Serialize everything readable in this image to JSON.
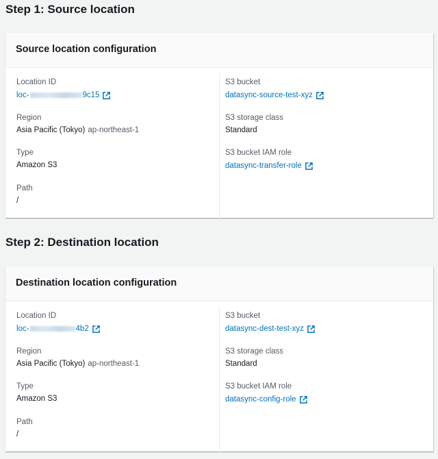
{
  "steps": [
    {
      "heading": "Step 1: Source location",
      "card_title": "Source location configuration",
      "left": [
        {
          "label": "Location ID",
          "value_prefix": "loc-",
          "value_suffix": "9c15",
          "link": true
        },
        {
          "label": "Region",
          "value": "Asia Pacific (Tokyo)",
          "value_sub": "ap-northeast-1"
        },
        {
          "label": "Type",
          "value": "Amazon S3"
        },
        {
          "label": "Path",
          "value": "/"
        }
      ],
      "right": [
        {
          "label": "S3 bucket",
          "value": "datasync-source-test-xyz",
          "link": true
        },
        {
          "label": "S3 storage class",
          "value": "Standard"
        },
        {
          "label": "S3 bucket IAM role",
          "value": "datasync-transfer-role",
          "link": true
        }
      ]
    },
    {
      "heading": "Step 2: Destination location",
      "card_title": "Destination location configuration",
      "left": [
        {
          "label": "Location ID",
          "value_prefix": "loc-",
          "value_suffix": "4b2",
          "link": true
        },
        {
          "label": "Region",
          "value": "Asia Pacific (Tokyo)",
          "value_sub": "ap-northeast-1"
        },
        {
          "label": "Type",
          "value": "Amazon S3"
        },
        {
          "label": "Path",
          "value": "/"
        }
      ],
      "right": [
        {
          "label": "S3 bucket",
          "value": "datasync-dest-test-xyz",
          "link": true
        },
        {
          "label": "S3 storage class",
          "value": "Standard"
        },
        {
          "label": "S3 bucket IAM role",
          "value": "datasync-config-role",
          "link": true
        }
      ]
    }
  ],
  "colors": {
    "link": "#0073bb",
    "label": "#545b64"
  }
}
